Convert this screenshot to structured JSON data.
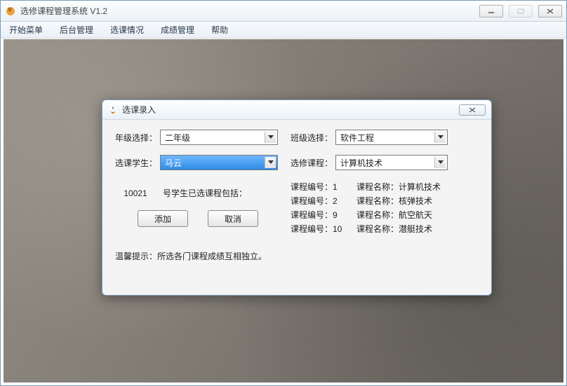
{
  "window": {
    "title": "选修课程管理系统 V1.2"
  },
  "menu": {
    "items": [
      "开始菜单",
      "后台管理",
      "选课情况",
      "成绩管理",
      "帮助"
    ]
  },
  "dialog": {
    "title": "选课录入",
    "labels": {
      "grade": "年级选择：",
      "class": "班级选择：",
      "student": "选课学生：",
      "course": "选修课程："
    },
    "values": {
      "grade": "二年级",
      "class": "软件工程",
      "student": "马云",
      "course": "计算机技术"
    },
    "student_id": "10021",
    "student_courses_label": "号学生已选课程包括：",
    "buttons": {
      "add": "添加",
      "cancel": "取消"
    },
    "course_id_prefix": "课程编号：",
    "course_name_prefix": "课程名称：",
    "courses": [
      {
        "id": "1",
        "name": "计算机技术"
      },
      {
        "id": "2",
        "name": "核弹技术"
      },
      {
        "id": "9",
        "name": "航空航天"
      },
      {
        "id": "10",
        "name": "潜艇技术"
      }
    ],
    "hint": "温馨提示：所选各门课程成绩互相独立。"
  }
}
